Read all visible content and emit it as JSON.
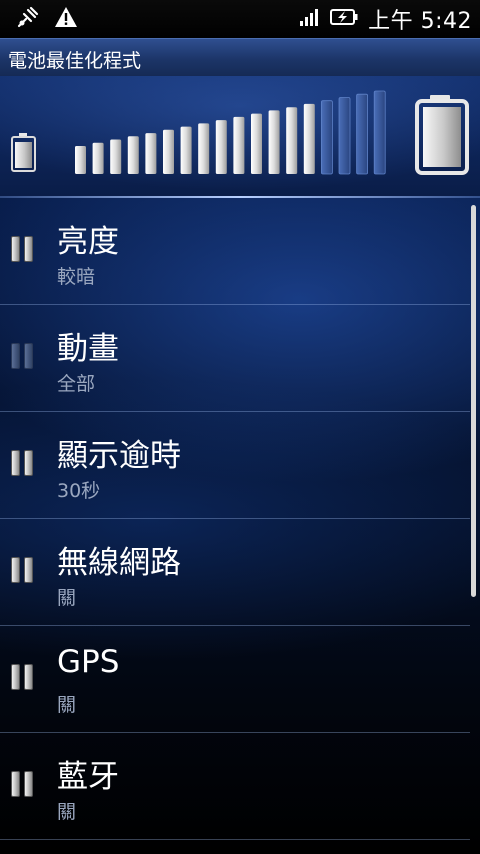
{
  "status_bar": {
    "icons": [
      "usb-debug-icon",
      "warning-icon",
      "signal-icon",
      "battery-charging-icon"
    ],
    "clock": "上午 5:42"
  },
  "app": {
    "title": "電池最佳化程式"
  },
  "battery_graph": {
    "total_bars": 18,
    "filled_bars": 14,
    "colors": {
      "filled": "#ffffff",
      "empty": "#3a5a9c"
    }
  },
  "settings": [
    {
      "title": "亮度",
      "value": "較暗",
      "toggle": "on"
    },
    {
      "title": "動畫",
      "value": "全部",
      "toggle": "dim"
    },
    {
      "title": "顯示逾時",
      "value": "30秒",
      "toggle": "on"
    },
    {
      "title": "無線網路",
      "value": "關",
      "toggle": "on"
    },
    {
      "title": "GPS",
      "value": "關",
      "toggle": "on"
    },
    {
      "title": "藍牙",
      "value": "關",
      "toggle": "on"
    }
  ]
}
